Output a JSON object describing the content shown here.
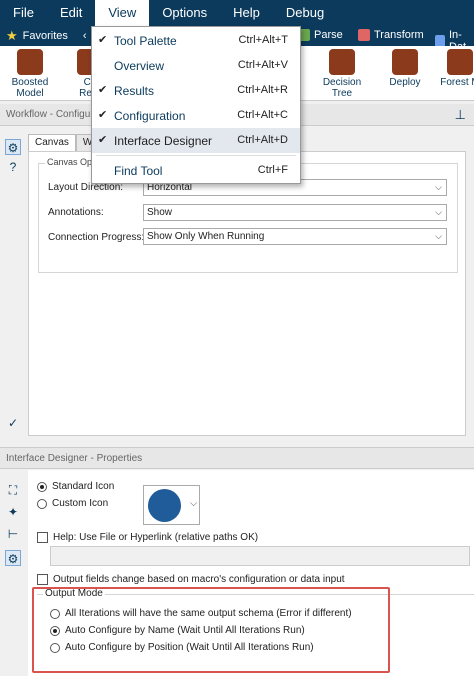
{
  "menubar": {
    "items": [
      {
        "label": "File",
        "active": false
      },
      {
        "label": "Edit",
        "active": false
      },
      {
        "label": "View",
        "active": true
      },
      {
        "label": "Options",
        "active": false
      },
      {
        "label": "Help",
        "active": false
      },
      {
        "label": "Debug",
        "active": false
      }
    ]
  },
  "categories": {
    "favorites_label": "Favorites",
    "items": [
      {
        "label": "Parse",
        "icon": "parse-icon",
        "color": "#6aa84f"
      },
      {
        "label": "Transform",
        "icon": "transform-icon",
        "color": "#e06666"
      },
      {
        "label": "In-Dat",
        "icon": "in-database-icon",
        "color": "#6d9eeb"
      }
    ]
  },
  "palette": {
    "tools": [
      {
        "label": "Boosted\nModel",
        "icon": "boosted-model-icon",
        "color": "#8b3a1c"
      },
      {
        "label": "Co\nRegr",
        "icon": "regression-icon",
        "color": "#8b3a1c"
      },
      {
        "label": "Decision Tree",
        "icon": "decision-tree-icon",
        "color": "#8b3a1c"
      },
      {
        "label": "Deploy",
        "icon": "deploy-icon",
        "color": "#8b3a1c"
      },
      {
        "label": "Forest M",
        "icon": "forest-model-icon",
        "color": "#8b3a1c"
      }
    ]
  },
  "view_menu": {
    "items": [
      {
        "label": "Tool Palette",
        "shortcut": "Ctrl+Alt+T",
        "checked": true
      },
      {
        "label": "Overview",
        "shortcut": "Ctrl+Alt+V",
        "checked": false
      },
      {
        "label": "Results",
        "shortcut": "Ctrl+Alt+R",
        "checked": true
      },
      {
        "label": "Configuration",
        "shortcut": "Ctrl+Alt+C",
        "checked": true
      },
      {
        "label": "Interface Designer",
        "shortcut": "Ctrl+Alt+D",
        "checked": true,
        "highlighted": true
      },
      {
        "label": "Find Tool",
        "shortcut": "Ctrl+F",
        "checked": false
      }
    ]
  },
  "workflow": {
    "header": "Workflow - Configura",
    "tabs": [
      "Canvas",
      "Wor"
    ],
    "group_legend": "Canvas Opt",
    "fields": [
      {
        "label": "Layout Direction:",
        "value": "Horizontal"
      },
      {
        "label": "Annotations:",
        "value": "Show"
      },
      {
        "label": "Connection Progress:",
        "value": "Show Only When Running"
      }
    ]
  },
  "interface_designer": {
    "header": "Interface Designer - Properties",
    "standard_icon_label": "Standard Icon",
    "custom_icon_label": "Custom Icon",
    "icon_color": "#1f5c99",
    "help_label": "Help: Use File or Hyperlink (relative paths OK)",
    "help_value": "",
    "output_fields_label": "Output fields change based on macro's configuration or data input",
    "output_mode": {
      "legend": "Output Mode",
      "options": [
        {
          "label": "All Iterations will have the same output schema (Error if different)",
          "selected": false
        },
        {
          "label": "Auto Configure by Name (Wait Until All Iterations Run)",
          "selected": true
        },
        {
          "label": "Auto Configure by Position (Wait Until All Iterations Run)",
          "selected": false
        }
      ]
    }
  }
}
